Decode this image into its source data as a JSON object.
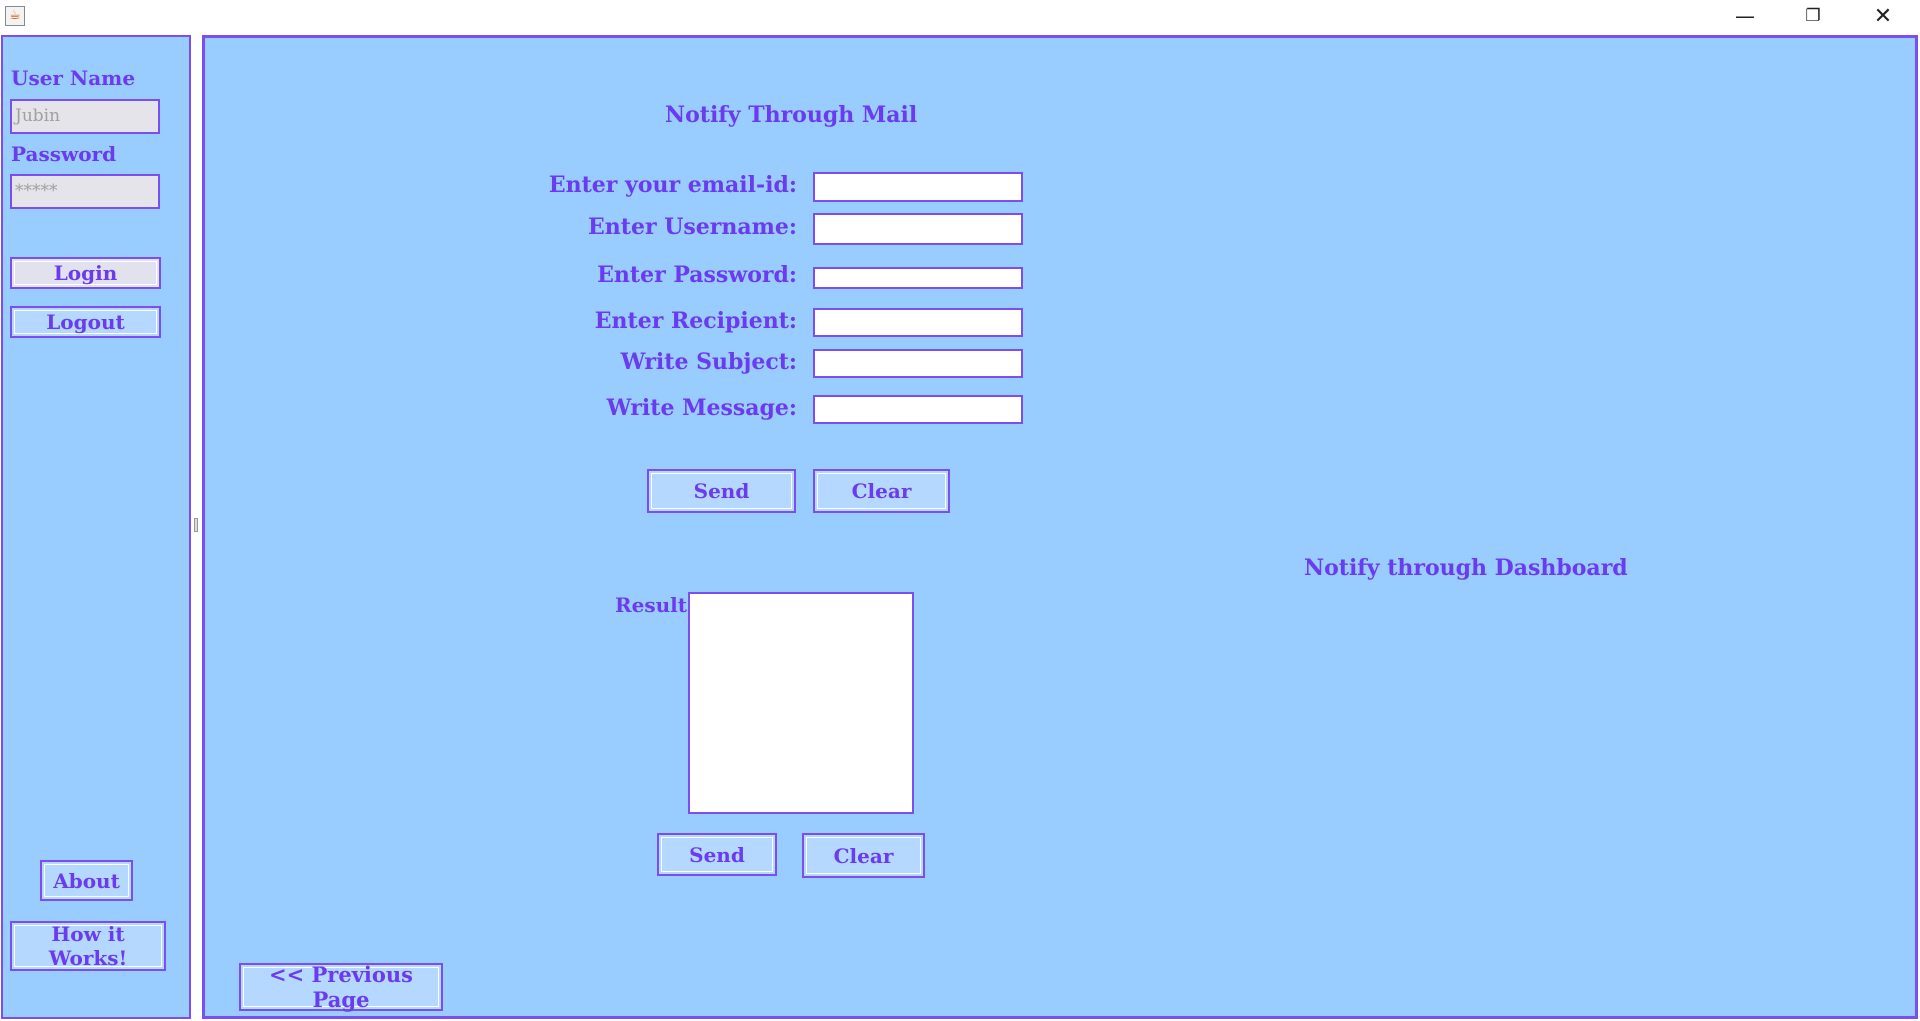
{
  "window": {
    "app_icon": "java-cup-icon",
    "controls": {
      "minimize": "—",
      "maximize": "❐",
      "close": "✕"
    }
  },
  "sidebar": {
    "username_label": "User Name",
    "username_value": "Jubin",
    "password_label": "Password",
    "password_value": "*****",
    "login_label": "Login",
    "logout_label": "Logout",
    "about_label": "About",
    "how_it_works_label": "How it Works!"
  },
  "mail_form": {
    "title": "Notify Through Mail",
    "email_label": "Enter your email-id:",
    "username_label": "Enter Username:",
    "password_label": "Enter Password:",
    "recipient_label": "Enter Recipient:",
    "subject_label": "Write Subject:",
    "message_label": "Write Message:",
    "send_label": "Send",
    "clear_label": "Clear"
  },
  "result": {
    "label": "Result:",
    "send_label": "Send",
    "clear_label": "Clear"
  },
  "dashboard": {
    "title": "Notify through Dashboard"
  },
  "navigation": {
    "previous_label": "<< Previous Page"
  },
  "colors": {
    "panel_background": "#99ccff",
    "accent": "#6b3bf0",
    "border": "#7a4ef0"
  }
}
